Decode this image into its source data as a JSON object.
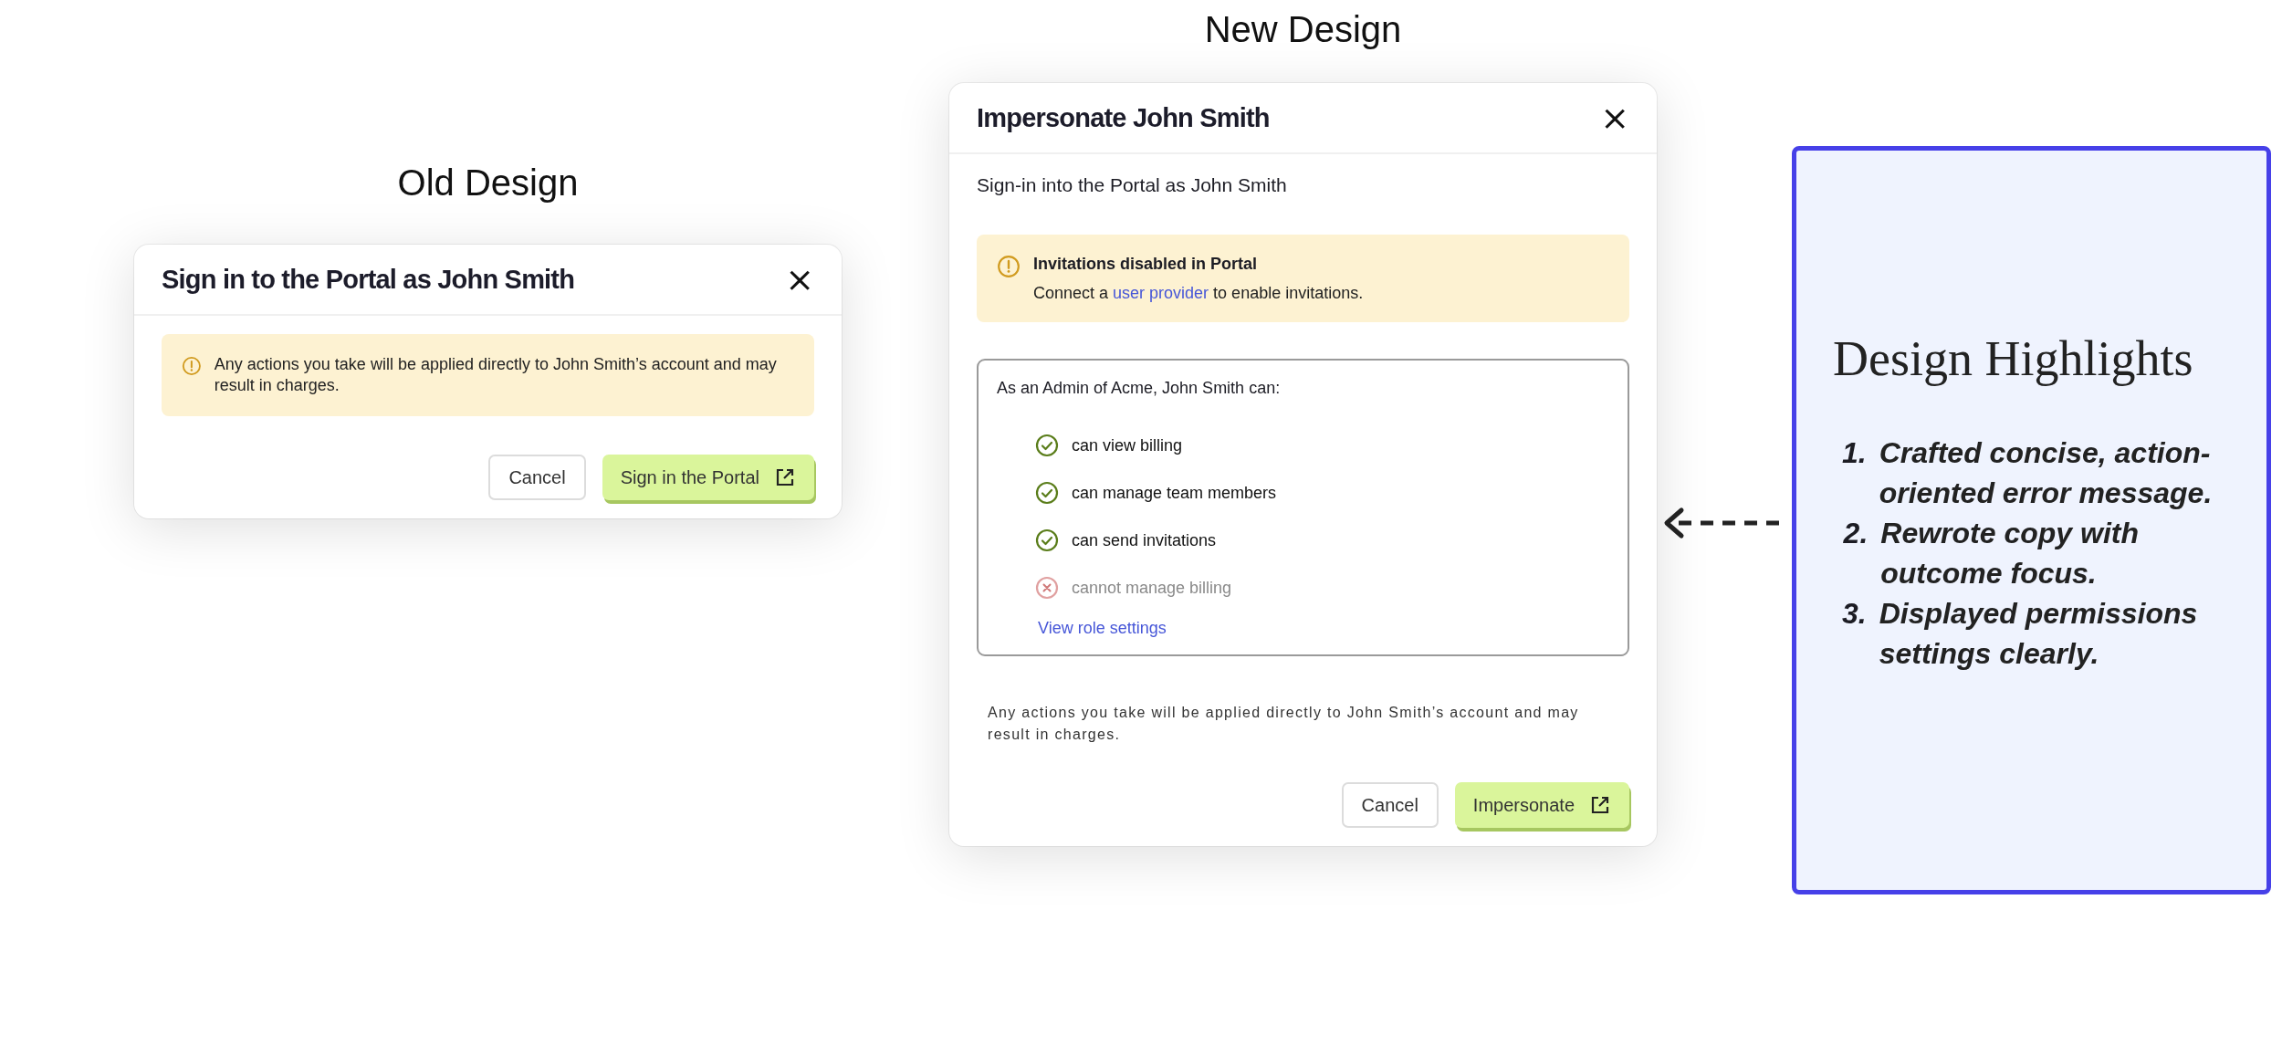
{
  "old_design": {
    "label": "Old Design",
    "dialog": {
      "title": "Sign in to the Portal as John Smith",
      "close": "×",
      "alert": {
        "kind": "warning",
        "text": "Any actions you take will be applied directly to John Smith’s account and may result in charges."
      },
      "buttons": [
        {
          "label": "Cancel",
          "kind": "secondary"
        },
        {
          "label": "Sign in the Portal",
          "kind": "primary"
        }
      ]
    }
  },
  "new_design": {
    "label": "New Design",
    "dialog": {
      "title": "Impersonate John Smith",
      "close": "×",
      "subtitle": "Sign-in into the Portal as John Smith",
      "alert": {
        "kind": "warning",
        "title": "Invitations disabled in Portal",
        "text_before": "Connect a ",
        "link": "user provider",
        "text_after": " to enable invitations."
      },
      "permissions": {
        "heading": "As an Admin of Acme, John Smith can:",
        "items": [
          {
            "label": "can view billing",
            "allowed": true
          },
          {
            "label": "can manage team members",
            "allowed": true
          },
          {
            "label": "can send invitations",
            "allowed": true
          },
          {
            "label": "cannot manage billing",
            "allowed": false
          }
        ],
        "link": "View role settings"
      },
      "note": "Any actions you take will be applied directly to John Smith’s account and may result in charges.",
      "buttons": [
        {
          "label": "Cancel",
          "kind": "secondary"
        },
        {
          "label": "Impersonate",
          "kind": "primary"
        }
      ]
    }
  },
  "highlights": {
    "title": "Design Highlights",
    "items": [
      {
        "number": "1.",
        "text": "Crafted concise, action-oriented error message."
      },
      {
        "number": "2.",
        "text": "Rewrote copy with outcome focus."
      },
      {
        "number": "3.",
        "text": "Displayed permissions settings clearly."
      }
    ]
  }
}
